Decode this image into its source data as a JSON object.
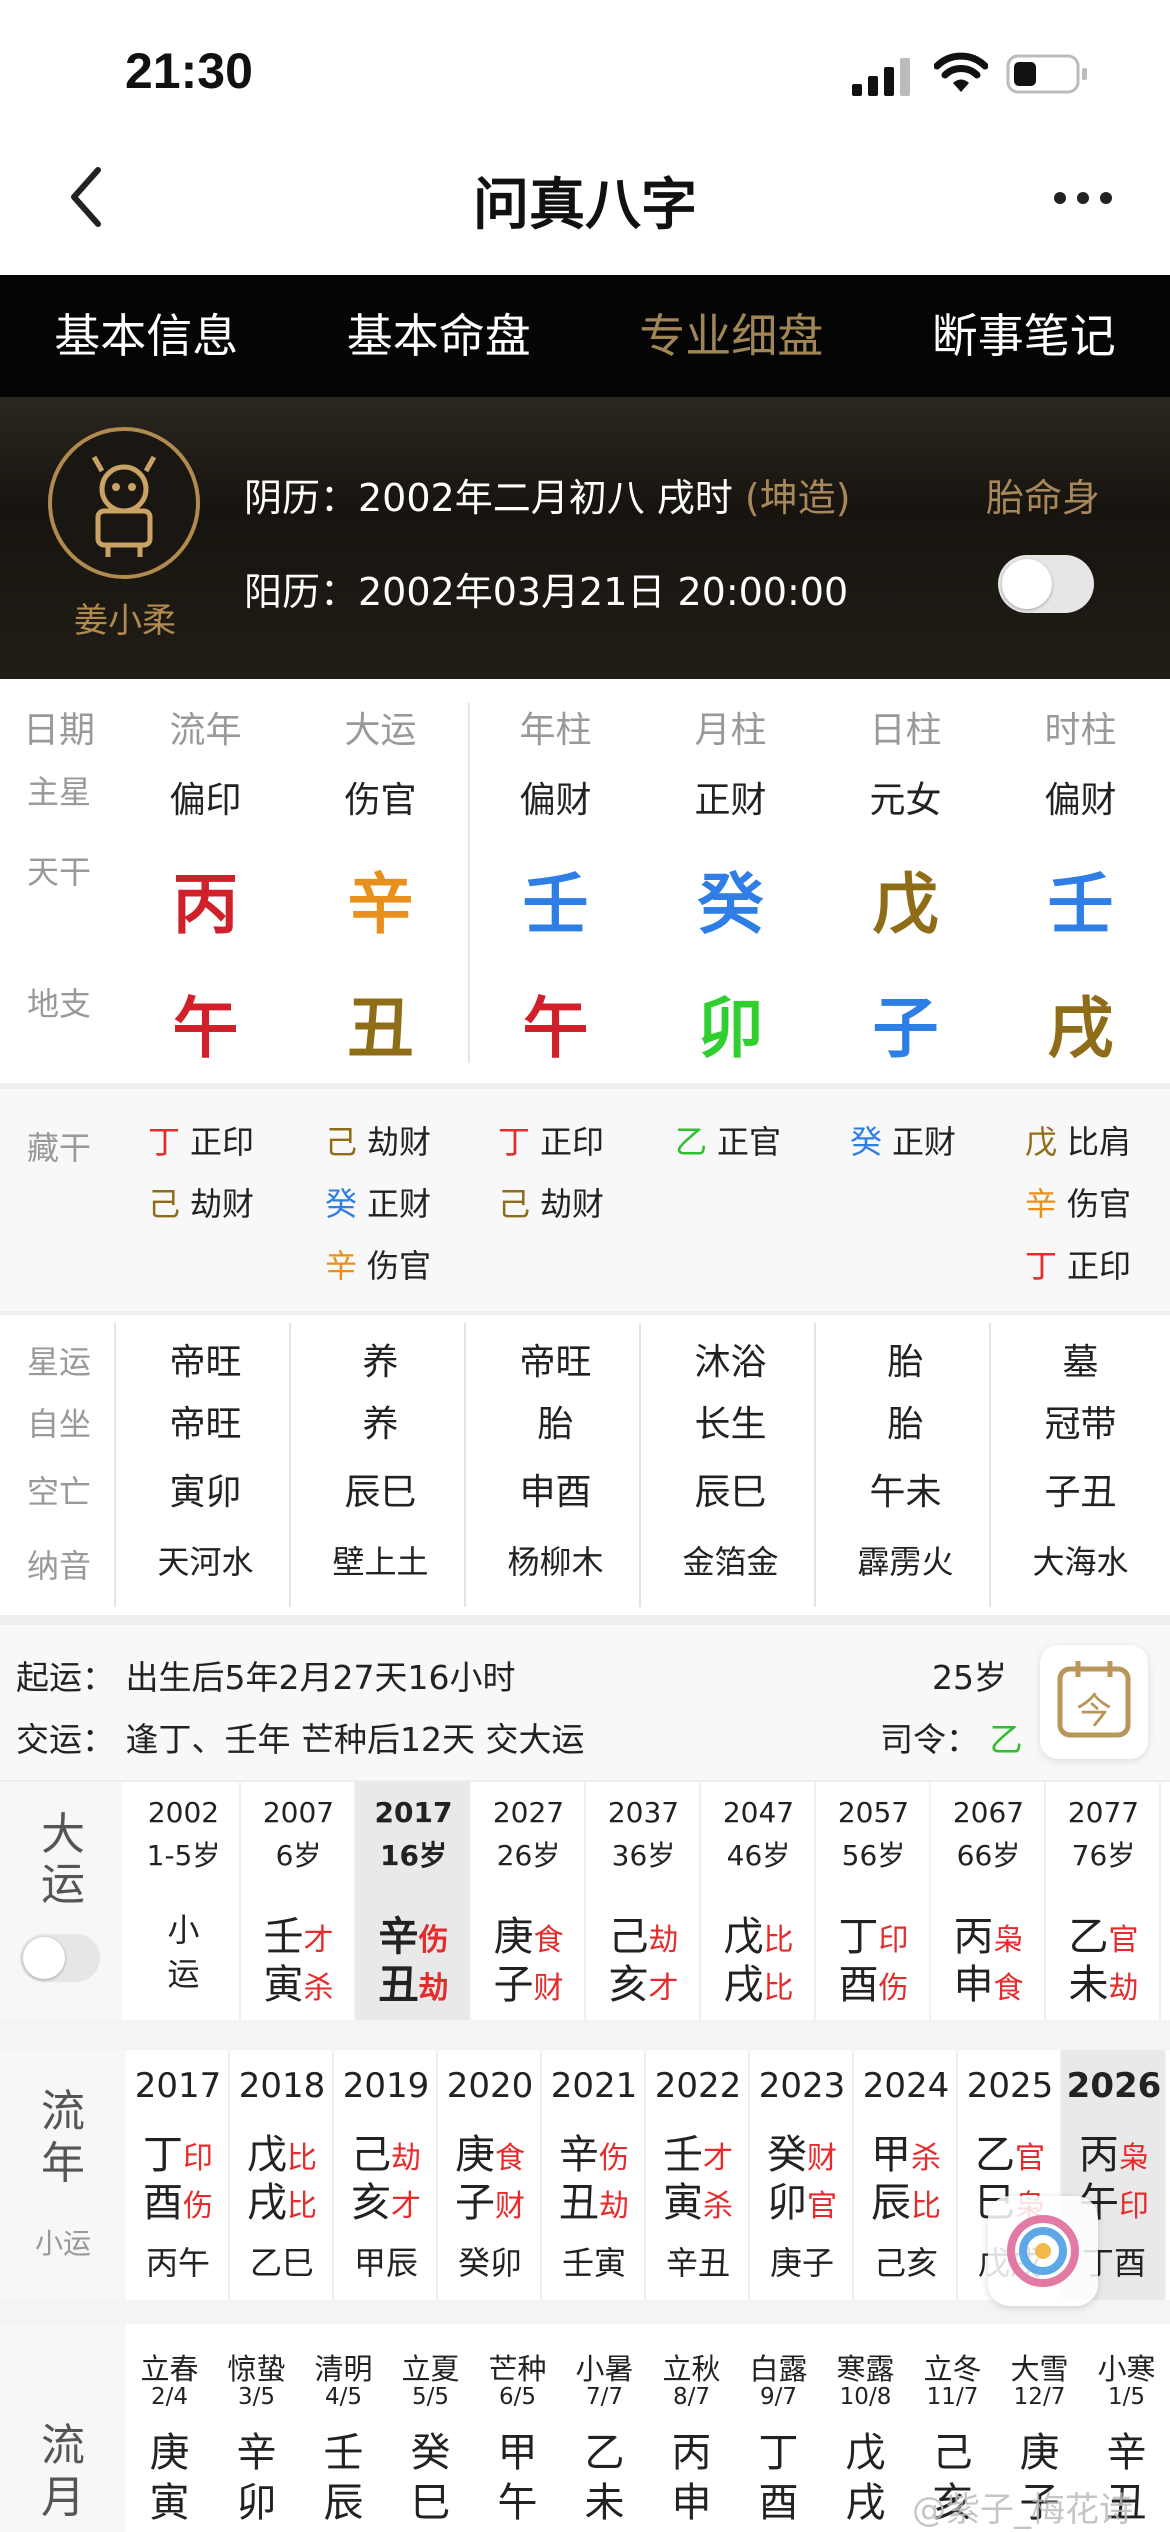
{
  "status_bar": {
    "time": "21:30"
  },
  "nav": {
    "title": "问真八字"
  },
  "tabs": [
    "基本信息",
    "基本命盘",
    "专业细盘",
    "断事笔记"
  ],
  "profile": {
    "name": "姜小柔",
    "lunar_prefix": "阴历：2002年二月初八  戌时",
    "lunar_tag": "(坤造)",
    "solar": "阳历：2002年03月21日 20:00:00",
    "taiming": "胎命身"
  },
  "pillars": {
    "row_labels": [
      "日期",
      "主星",
      "天干",
      "地支"
    ],
    "columns": [
      {
        "head": "流年",
        "star": "偏印",
        "stem": "丙",
        "stem_color": "#d0202a",
        "branch": "午",
        "branch_color": "#d0202a"
      },
      {
        "head": "大运",
        "star": "伤官",
        "stem": "辛",
        "stem_color": "#e8901e",
        "branch": "丑",
        "branch_color": "#8f6c17"
      },
      {
        "head": "年柱",
        "star": "偏财",
        "stem": "壬",
        "stem_color": "#2f7ee6",
        "branch": "午",
        "branch_color": "#d0202a"
      },
      {
        "head": "月柱",
        "star": "正财",
        "stem": "癸",
        "stem_color": "#2f7ee6",
        "branch": "卯",
        "branch_color": "#2fcf2f"
      },
      {
        "head": "日柱",
        "star": "元女",
        "stem": "戊",
        "stem_color": "#8f6c17",
        "branch": "子",
        "branch_color": "#2f7ee6"
      },
      {
        "head": "时柱",
        "star": "偏财",
        "stem": "壬",
        "stem_color": "#2f7ee6",
        "branch": "戌",
        "branch_color": "#8f6c17"
      }
    ]
  },
  "canggan": {
    "label": "藏干",
    "columns": [
      [
        {
          "g": "丁",
          "c": "#e52b2b",
          "t": "正印"
        },
        {
          "g": "己",
          "c": "#8f6c17",
          "t": "劫财"
        }
      ],
      [
        {
          "g": "己",
          "c": "#8f6c17",
          "t": "劫财"
        },
        {
          "g": "癸",
          "c": "#2f7ee6",
          "t": "正财"
        },
        {
          "g": "辛",
          "c": "#e8901e",
          "t": "伤官"
        }
      ],
      [
        {
          "g": "丁",
          "c": "#e52b2b",
          "t": "正印"
        },
        {
          "g": "己",
          "c": "#8f6c17",
          "t": "劫财"
        }
      ],
      [
        {
          "g": "乙",
          "c": "#2fbf2f",
          "t": "正官"
        }
      ],
      [
        {
          "g": "癸",
          "c": "#2f7ee6",
          "t": "正财"
        }
      ],
      [
        {
          "g": "戊",
          "c": "#8f6c17",
          "t": "比肩"
        },
        {
          "g": "辛",
          "c": "#e8901e",
          "t": "伤官"
        },
        {
          "g": "丁",
          "c": "#e52b2b",
          "t": "正印"
        }
      ]
    ]
  },
  "shensha": {
    "labels": [
      "星运",
      "自坐",
      "空亡",
      "纳音"
    ],
    "columns": [
      [
        "帝旺",
        "帝旺",
        "寅卯",
        "天河水"
      ],
      [
        "养",
        "养",
        "辰巳",
        "壁上土"
      ],
      [
        "帝旺",
        "胎",
        "申酉",
        "杨柳木"
      ],
      [
        "沐浴",
        "长生",
        "辰巳",
        "金箔金"
      ],
      [
        "胎",
        "胎",
        "午未",
        "霹雳火"
      ],
      [
        "墓",
        "冠带",
        "子丑",
        "大海水"
      ]
    ]
  },
  "qiyun": {
    "line1": "起运：  出生后5年2月27天16小时",
    "age": "25岁",
    "line2": "交运：  逢丁、壬年 芒种后12天 交大运",
    "siling_label": "司令：",
    "siling_value": "乙"
  },
  "dayun": {
    "label": "大运",
    "items": [
      {
        "year": "2002",
        "age": "1-5岁",
        "small": "小运",
        "gz1": "",
        "t1": "",
        "gz2": "",
        "t2": ""
      },
      {
        "year": "2007",
        "age": "6岁",
        "gz1": "壬",
        "t1": "才",
        "gz2": "寅",
        "t2": "杀"
      },
      {
        "year": "2017",
        "age": "16岁",
        "gz1": "辛",
        "t1": "伤",
        "gz2": "丑",
        "t2": "劫",
        "active": true
      },
      {
        "year": "2027",
        "age": "26岁",
        "gz1": "庚",
        "t1": "食",
        "gz2": "子",
        "t2": "财"
      },
      {
        "year": "2037",
        "age": "36岁",
        "gz1": "己",
        "t1": "劫",
        "gz2": "亥",
        "t2": "才"
      },
      {
        "year": "2047",
        "age": "46岁",
        "gz1": "戊",
        "t1": "比",
        "gz2": "戌",
        "t2": "比"
      },
      {
        "year": "2057",
        "age": "56岁",
        "gz1": "丁",
        "t1": "印",
        "gz2": "酉",
        "t2": "伤"
      },
      {
        "year": "2067",
        "age": "66岁",
        "gz1": "丙",
        "t1": "枭",
        "gz2": "申",
        "t2": "食"
      },
      {
        "year": "2077",
        "age": "76岁",
        "gz1": "乙",
        "t1": "官",
        "gz2": "未",
        "t2": "劫"
      }
    ]
  },
  "liunian": {
    "label": "流年",
    "sublabel": "小运",
    "items": [
      {
        "year": "2017",
        "gz1": "丁",
        "t1": "印",
        "gz2": "酉",
        "t2": "伤",
        "xy": "丙午"
      },
      {
        "year": "2018",
        "gz1": "戊",
        "t1": "比",
        "gz2": "戌",
        "t2": "比",
        "xy": "乙巳"
      },
      {
        "year": "2019",
        "gz1": "己",
        "t1": "劫",
        "gz2": "亥",
        "t2": "才",
        "xy": "甲辰"
      },
      {
        "year": "2020",
        "gz1": "庚",
        "t1": "食",
        "gz2": "子",
        "t2": "财",
        "xy": "癸卯"
      },
      {
        "year": "2021",
        "gz1": "辛",
        "t1": "伤",
        "gz2": "丑",
        "t2": "劫",
        "xy": "壬寅"
      },
      {
        "year": "2022",
        "gz1": "壬",
        "t1": "才",
        "gz2": "寅",
        "t2": "杀",
        "xy": "辛丑"
      },
      {
        "year": "2023",
        "gz1": "癸",
        "t1": "财",
        "gz2": "卯",
        "t2": "官",
        "xy": "庚子"
      },
      {
        "year": "2024",
        "gz1": "甲",
        "t1": "杀",
        "gz2": "辰",
        "t2": "比",
        "xy": "己亥"
      },
      {
        "year": "2025",
        "gz1": "乙",
        "t1": "官",
        "gz2": "巳",
        "t2": "枭",
        "xy": "戊戌"
      },
      {
        "year": "2026",
        "gz1": "丙",
        "t1": "枭",
        "gz2": "午",
        "t2": "印",
        "xy": "丁酉",
        "active": true
      }
    ]
  },
  "liuyue": {
    "label": "流月",
    "items": [
      {
        "term": "立春",
        "date": "2/4",
        "g": "庚",
        "z": "寅"
      },
      {
        "term": "惊蛰",
        "date": "3/5",
        "g": "辛",
        "z": "卯"
      },
      {
        "term": "清明",
        "date": "4/5",
        "g": "壬",
        "z": "辰"
      },
      {
        "term": "立夏",
        "date": "5/5",
        "g": "癸",
        "z": "巳"
      },
      {
        "term": "芒种",
        "date": "6/5",
        "g": "甲",
        "z": "午"
      },
      {
        "term": "小暑",
        "date": "7/7",
        "g": "乙",
        "z": "未"
      },
      {
        "term": "立秋",
        "date": "8/7",
        "g": "丙",
        "z": "申"
      },
      {
        "term": "白露",
        "date": "9/7",
        "g": "丁",
        "z": "酉"
      },
      {
        "term": "寒露",
        "date": "10/8",
        "g": "戊",
        "z": "戌"
      },
      {
        "term": "立冬",
        "date": "11/7",
        "g": "己",
        "z": "亥"
      },
      {
        "term": "大雪",
        "date": "12/7",
        "g": "庚",
        "z": "子"
      },
      {
        "term": "小寒",
        "date": "1/5",
        "g": "辛",
        "z": "丑"
      }
    ]
  },
  "watermark": "@紫子_梅花诗"
}
